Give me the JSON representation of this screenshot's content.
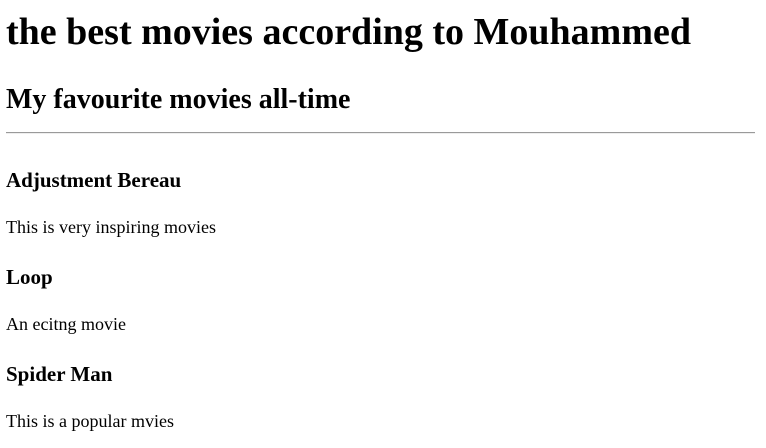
{
  "header": {
    "title": "the best movies according to Mouhammed",
    "subtitle": "My favourite movies all-time"
  },
  "movies": [
    {
      "title": "Adjustment Bereau",
      "description": "This is very inspiring movies"
    },
    {
      "title": "Loop",
      "description": "An ecitng movie"
    },
    {
      "title": "Spider Man",
      "description": "This is a popular mvies"
    }
  ]
}
